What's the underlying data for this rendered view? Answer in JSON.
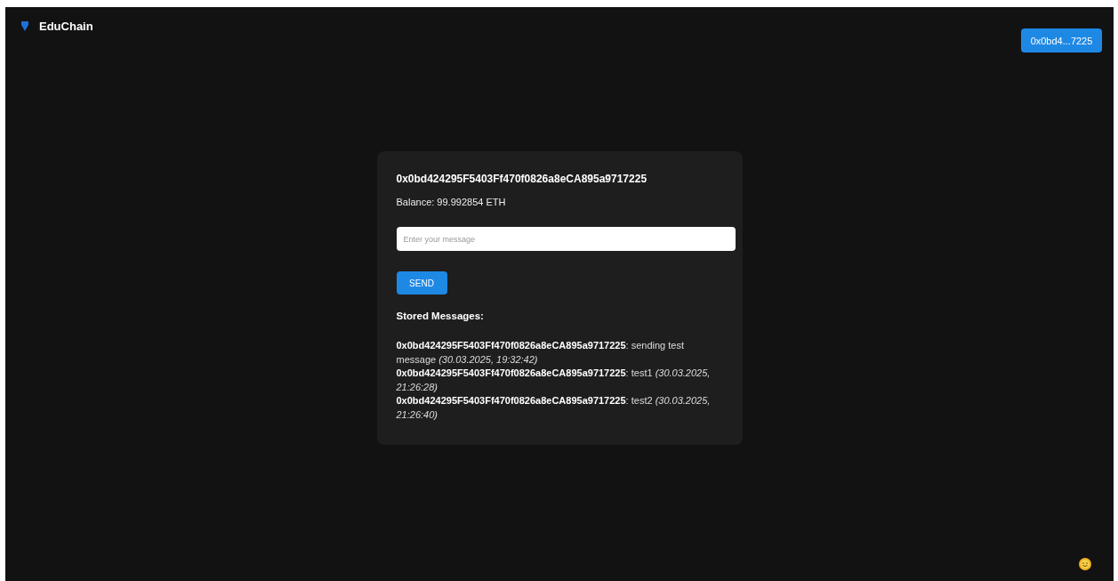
{
  "header": {
    "brand": "EduChain",
    "wallet_button": "0x0bd4...7225"
  },
  "card": {
    "address": "0x0bd424295F5403Ff470f0826a8eCA895a9717225",
    "balance": "Balance: 99.992854 ETH",
    "message_input": {
      "placeholder": "Enter your message"
    },
    "send_button": "SEND",
    "messages_heading": "Stored Messages:",
    "messages": [
      "**0x0bd424295F5403Ff470f0826a8eCA895a9717225**: sending test message *(30.03.2025, 19:32:42)*",
      "**0x0bd424295F5403Ff470f0826a8eCA895a9717225**: test1 *(30.03.2025, 21:26:28)*",
      "**0x0bd424295F5403Ff470f0826a8eCA895a9717225**: test2 *(30.03.2025, 21:26:40)*"
    ]
  }
}
